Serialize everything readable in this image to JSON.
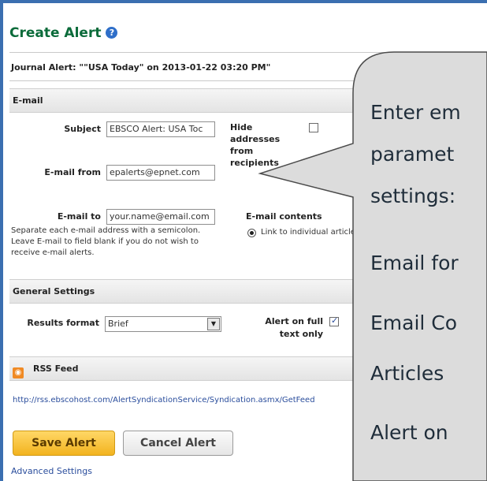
{
  "title": "Create Alert",
  "journal_alert": "Journal Alert: \"\"USA Today\" on 2013-01-22 03:20 PM\"",
  "sections": {
    "email": "E-mail",
    "general": "General Settings",
    "rss": "RSS Feed"
  },
  "email": {
    "subject_label": "Subject",
    "subject_value": "EBSCO Alert: USA Toc",
    "from_label": "E-mail from",
    "from_value": "epalerts@epnet.com",
    "to_label": "E-mail to",
    "to_value": "your.name@email.com",
    "to_note_1": "Separate each e-mail address with a semicolon.",
    "to_note_2": "Leave E-mail to field blank if you do not wish to",
    "to_note_3": "receive e-mail alerts.",
    "hide_label_1": "Hide addresses",
    "hide_label_2": "from recipients",
    "contents_label": "E-mail contents",
    "contents_option": "Link to individual articles"
  },
  "general": {
    "results_format_label": "Results format",
    "results_format_value": "Brief",
    "full_text_label_1": "Alert on full",
    "full_text_label_2": "text only"
  },
  "rss": {
    "url": "http://rss.ebscohost.com/AlertSyndicationService/Syndication.asmx/GetFeed"
  },
  "buttons": {
    "save": "Save Alert",
    "cancel": "Cancel Alert"
  },
  "advanced_settings": "Advanced Settings",
  "callout": {
    "lines": [
      "Enter em",
      "paramet",
      "settings:",
      "Email for",
      "Email Co",
      "Articles",
      "Alert on"
    ]
  },
  "colors": {
    "title_green": "#0b6b3a",
    "link_blue": "#2a4d9c",
    "save_button": "#f2b31f",
    "callout_fill": "#dcdcdc"
  }
}
